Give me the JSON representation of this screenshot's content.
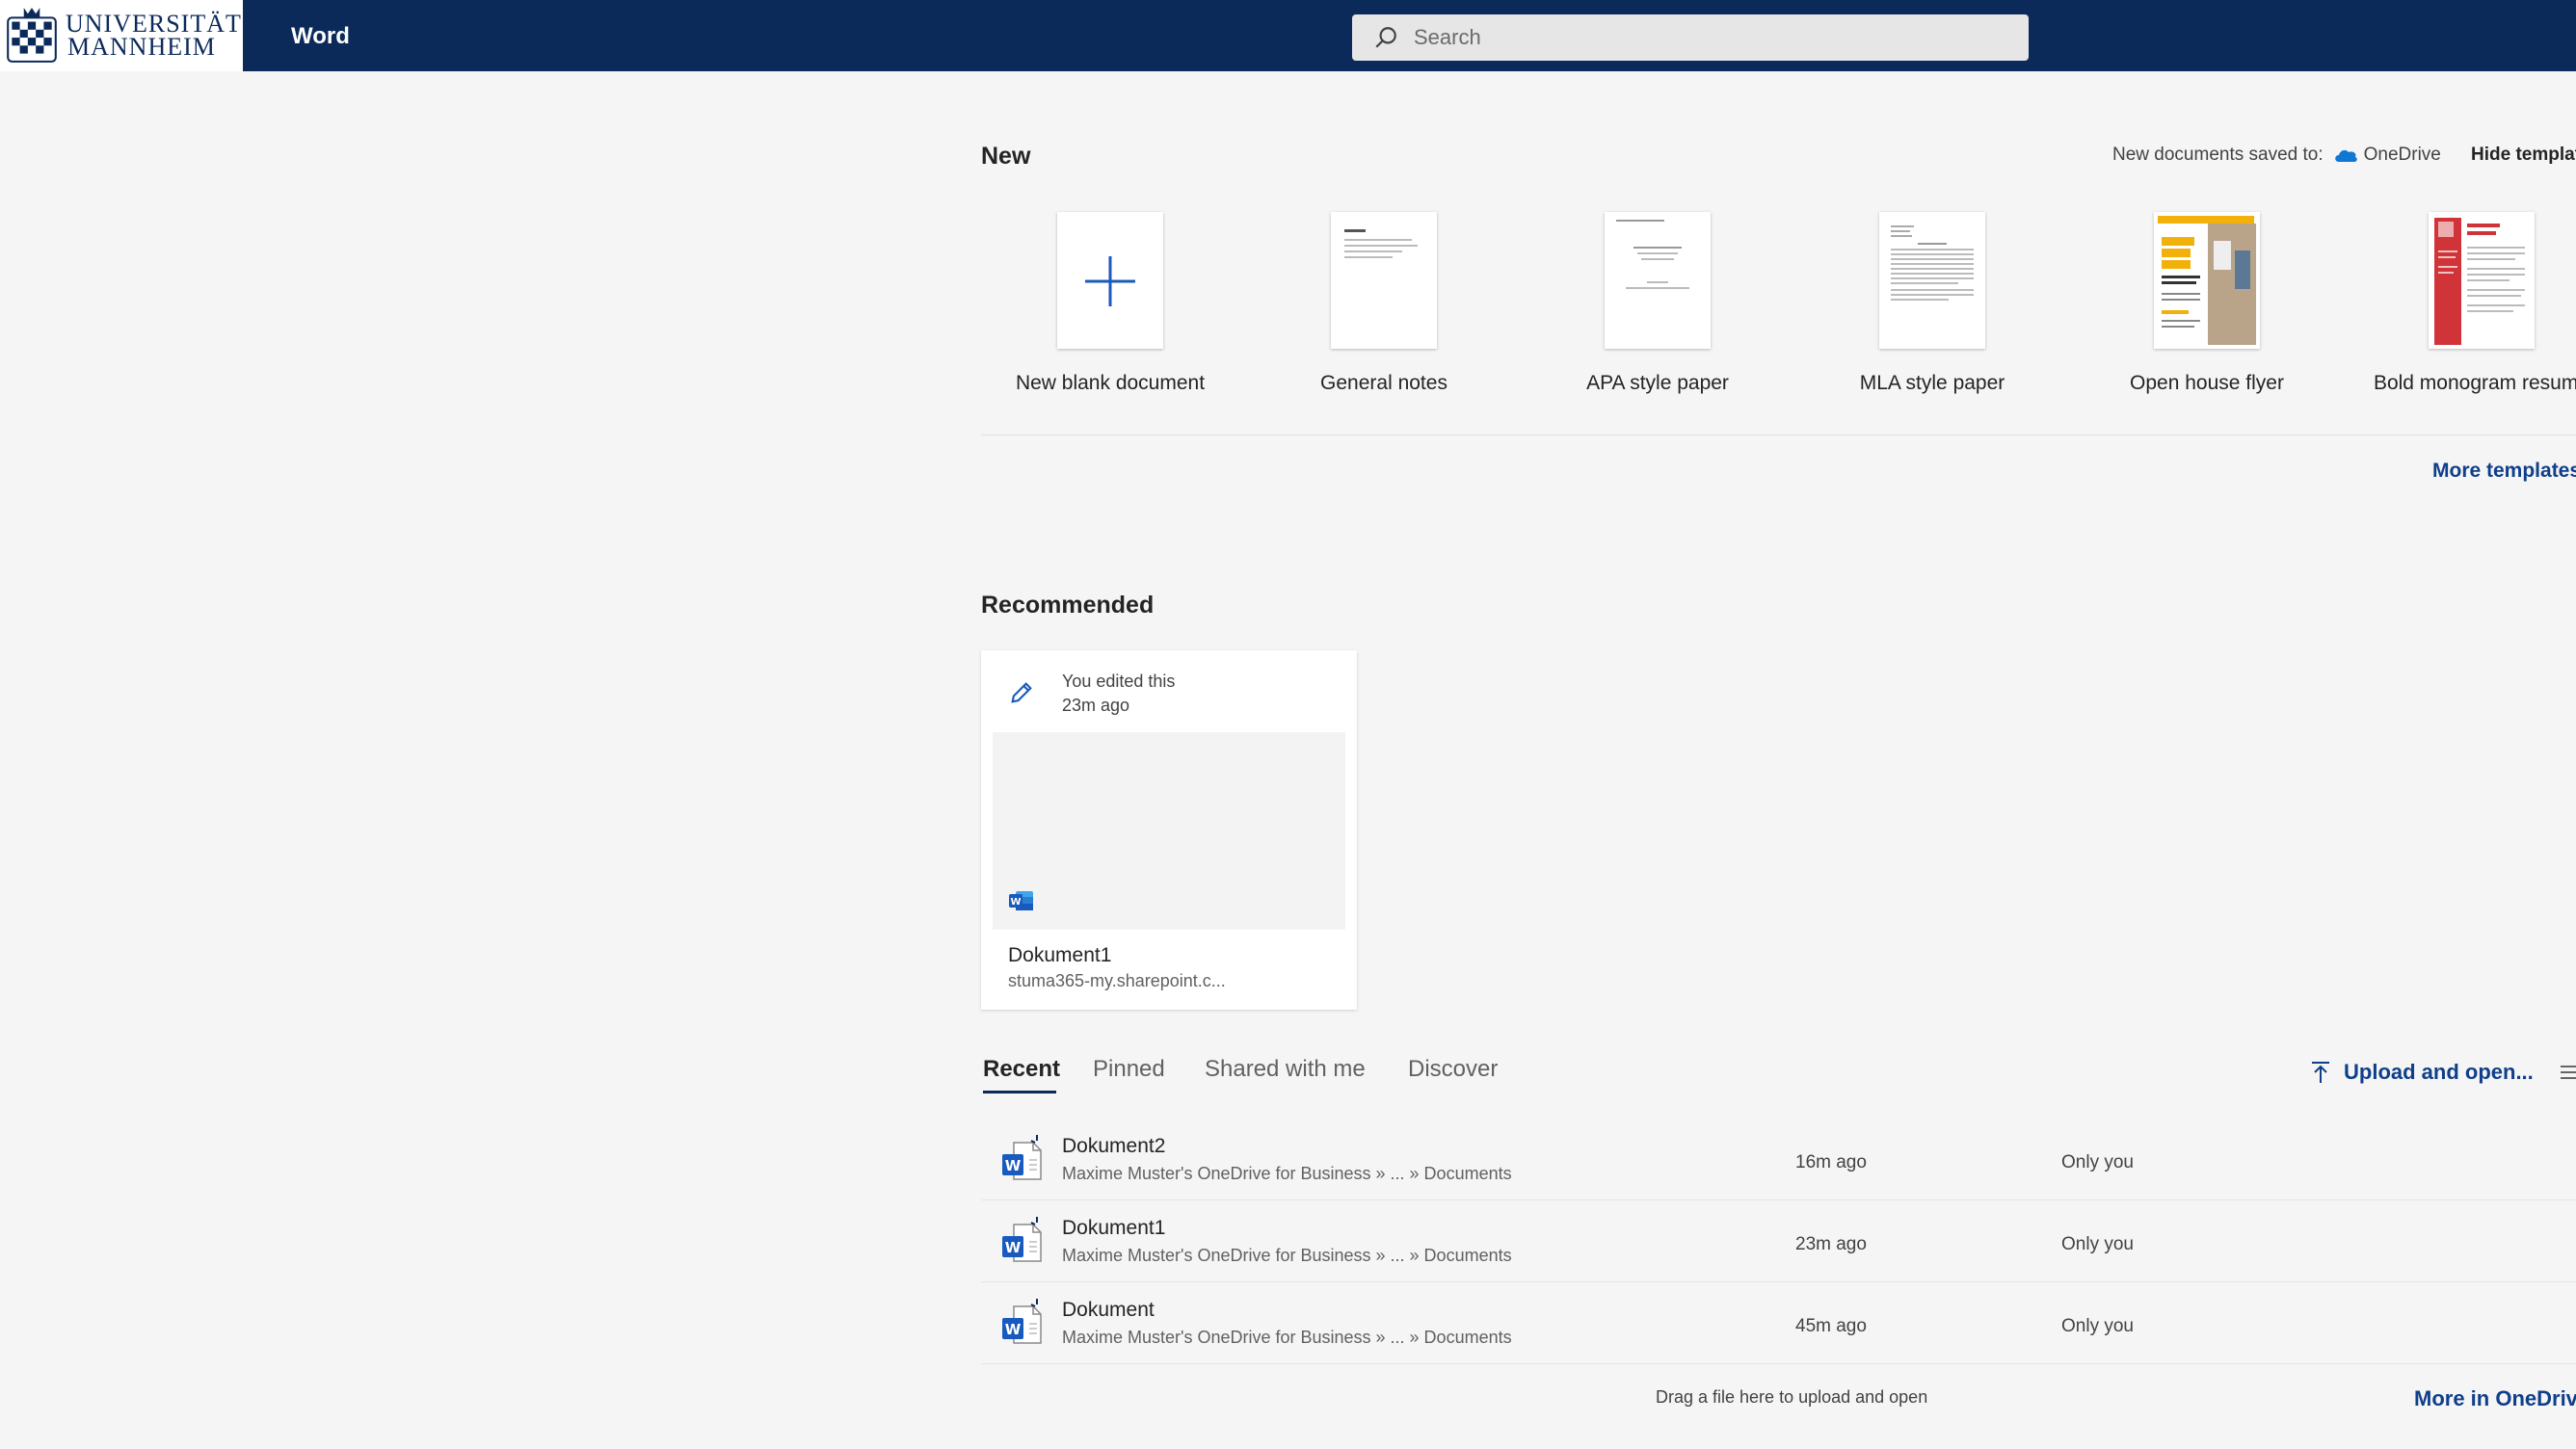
{
  "header": {
    "logo_line1": "UNIVERSITÄT",
    "logo_line2": "MANNHEIM",
    "app_name": "Word",
    "search_placeholder": "Search"
  },
  "new_section": {
    "title": "New",
    "saved_to_label": "New documents saved to:",
    "saved_to_location": "OneDrive",
    "hide_templates": "Hide templates",
    "templates": [
      {
        "label": "New blank document",
        "icon": "plus-icon"
      },
      {
        "label": "General notes"
      },
      {
        "label": "APA style paper"
      },
      {
        "label": "MLA style paper"
      },
      {
        "label": "Open house flyer"
      },
      {
        "label": "Bold monogram resume"
      }
    ],
    "more_templates": "More templates"
  },
  "recommended": {
    "title": "Recommended",
    "card": {
      "activity_line1": "You edited this",
      "activity_line2": "23m ago",
      "file_name": "Dokument1",
      "file_location": "stuma365-my.sharepoint.c..."
    }
  },
  "files": {
    "tabs": [
      "Recent",
      "Pinned",
      "Shared with me",
      "Discover"
    ],
    "active_tab": "Recent",
    "upload_label": "Upload and open...",
    "rows": [
      {
        "name": "Dokument2",
        "path": "Maxime Muster's OneDrive for Business » ... » Documents",
        "modified": "16m ago",
        "sharing": "Only you"
      },
      {
        "name": "Dokument1",
        "path": "Maxime Muster's OneDrive for Business » ... » Documents",
        "modified": "23m ago",
        "sharing": "Only you"
      },
      {
        "name": "Dokument",
        "path": "Maxime Muster's OneDrive for Business » ... » Documents",
        "modified": "45m ago",
        "sharing": "Only you"
      }
    ],
    "drag_hint": "Drag a file here to upload and open",
    "more_in_onedrive": "More in OneDrive"
  },
  "colors": {
    "header_bg": "#0b2a5a",
    "link": "#0f3f8a",
    "word_blue": "#185abd"
  }
}
